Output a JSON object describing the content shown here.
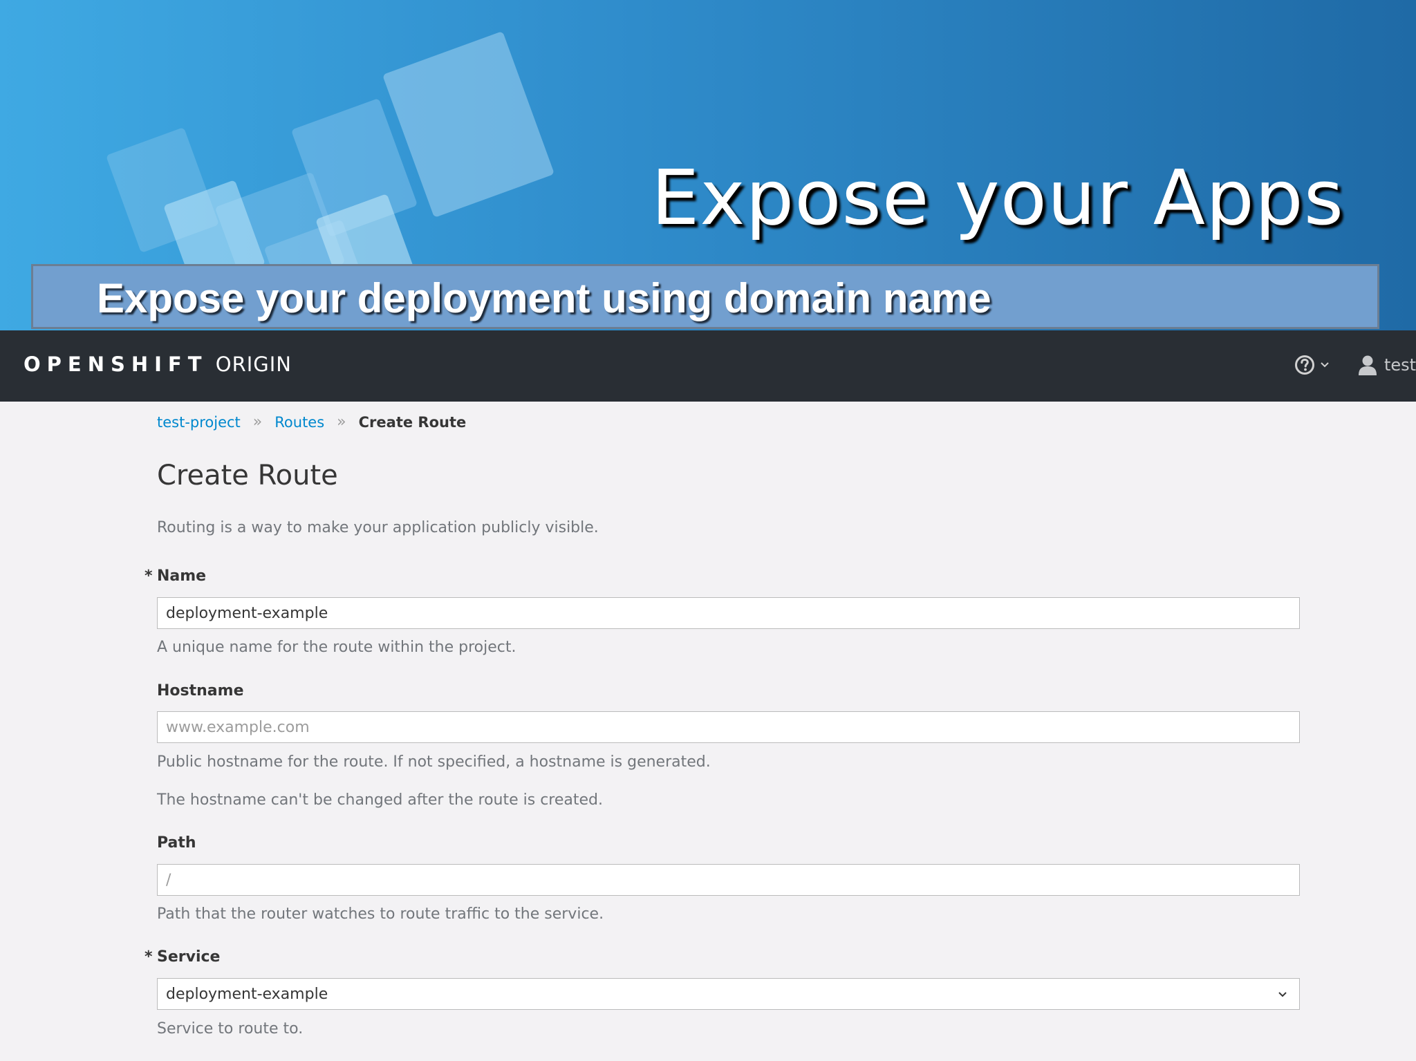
{
  "slide": {
    "title": "Expose your Apps",
    "subtitle": "Expose your deployment using domain name"
  },
  "navbar": {
    "brand_main": "OPENSHIFT",
    "brand_sub": "ORIGIN",
    "help_icon": "question-circle-icon",
    "user_icon": "user-icon",
    "username": "test"
  },
  "breadcrumb": {
    "project": "test-project",
    "routes": "Routes",
    "current": "Create Route"
  },
  "page": {
    "title": "Create Route",
    "description": "Routing is a way to make your application publicly visible."
  },
  "form": {
    "name": {
      "label": "Name",
      "required": "*",
      "value": "deployment-example",
      "help": "A unique name for the route within the project."
    },
    "hostname": {
      "label": "Hostname",
      "placeholder": "www.example.com",
      "help1": "Public hostname for the route. If not specified, a hostname is generated.",
      "help2": "The hostname can't be changed after the route is created."
    },
    "path": {
      "label": "Path",
      "placeholder": "/",
      "help": "Path that the router watches to route traffic to the service."
    },
    "service": {
      "label": "Service",
      "required": "*",
      "selected": "deployment-example",
      "help": "Service to route to."
    }
  },
  "colors": {
    "link": "#0088ce",
    "navbar_bg": "#292e34",
    "page_bg": "#f3f2f4",
    "subtitle_bar": "#729fcf"
  }
}
